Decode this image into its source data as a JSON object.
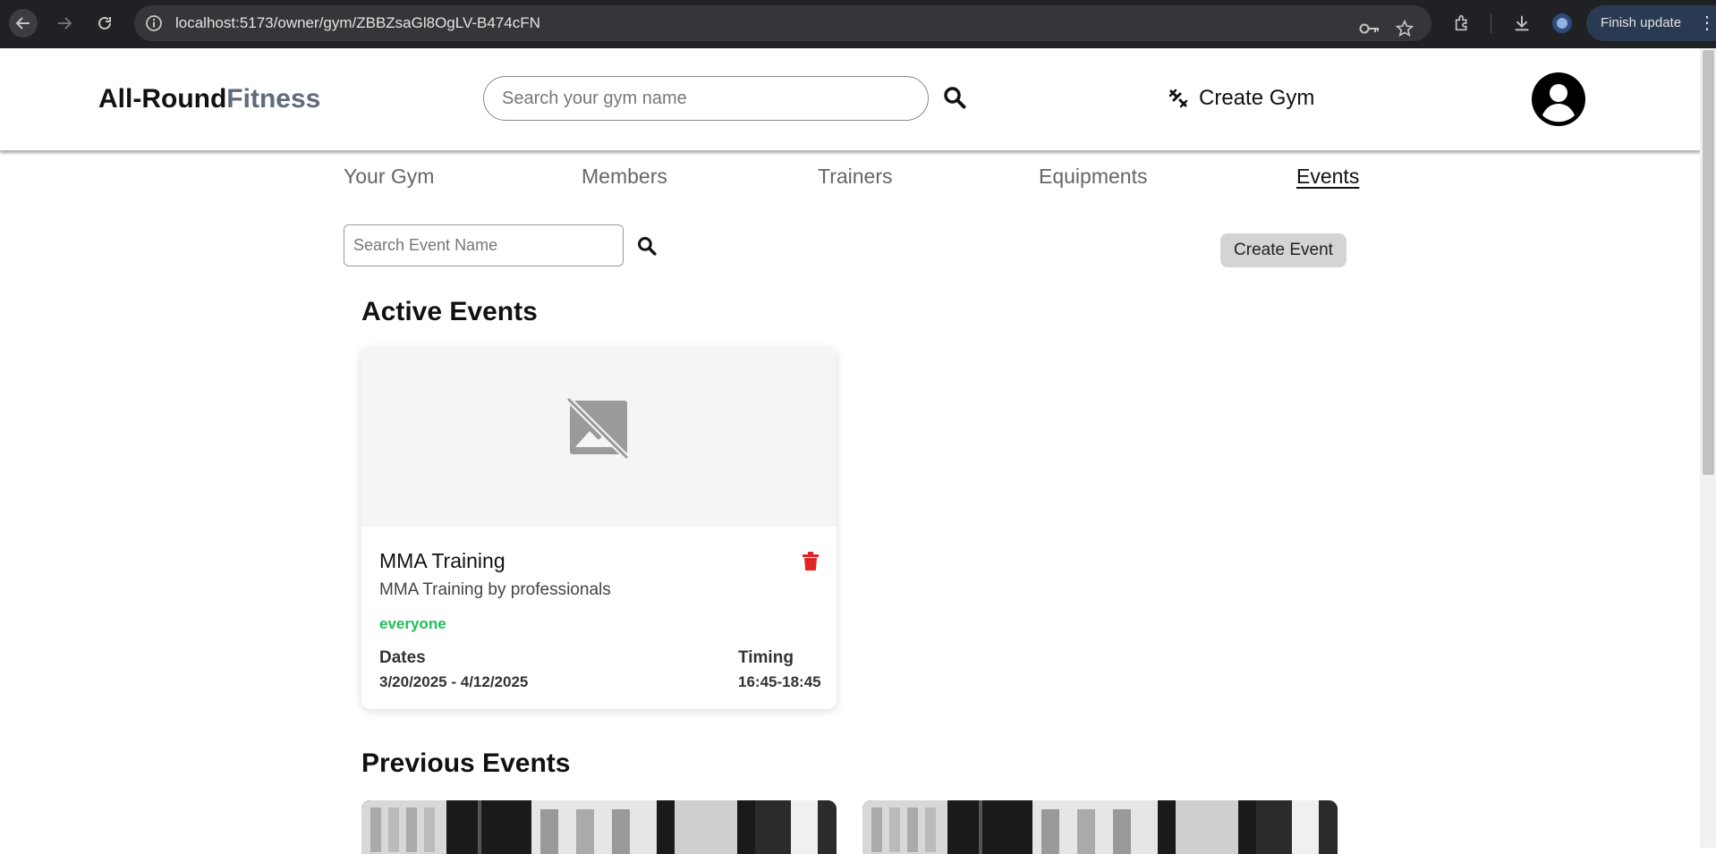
{
  "browser": {
    "url": "localhost:5173/owner/gym/ZBBZsaGl8OgLV-B474cFN",
    "finish_update": "Finish update"
  },
  "header": {
    "brand_part1": "All-Round",
    "brand_part2": "Fitness",
    "search_placeholder": "Search your gym name",
    "create_gym": "Create Gym"
  },
  "tabs": [
    {
      "label": "Your Gym"
    },
    {
      "label": "Members"
    },
    {
      "label": "Trainers"
    },
    {
      "label": "Equipments"
    },
    {
      "label": "Events"
    }
  ],
  "events_page": {
    "search_placeholder": "Search Event Name",
    "create_event": "Create Event",
    "active_title": "Active Events",
    "previous_title": "Previous Events"
  },
  "active_events": [
    {
      "title": "MMA Training",
      "description": "MMA Training by professionals",
      "audience": "everyone",
      "dates_label": "Dates",
      "dates": "3/20/2025 - 4/12/2025",
      "timing_label": "Timing",
      "timing": "16:45-18:45"
    }
  ],
  "colors": {
    "accent_audience": "#1fbf5a",
    "delete": "#e02424",
    "chrome_bg": "#202124"
  }
}
